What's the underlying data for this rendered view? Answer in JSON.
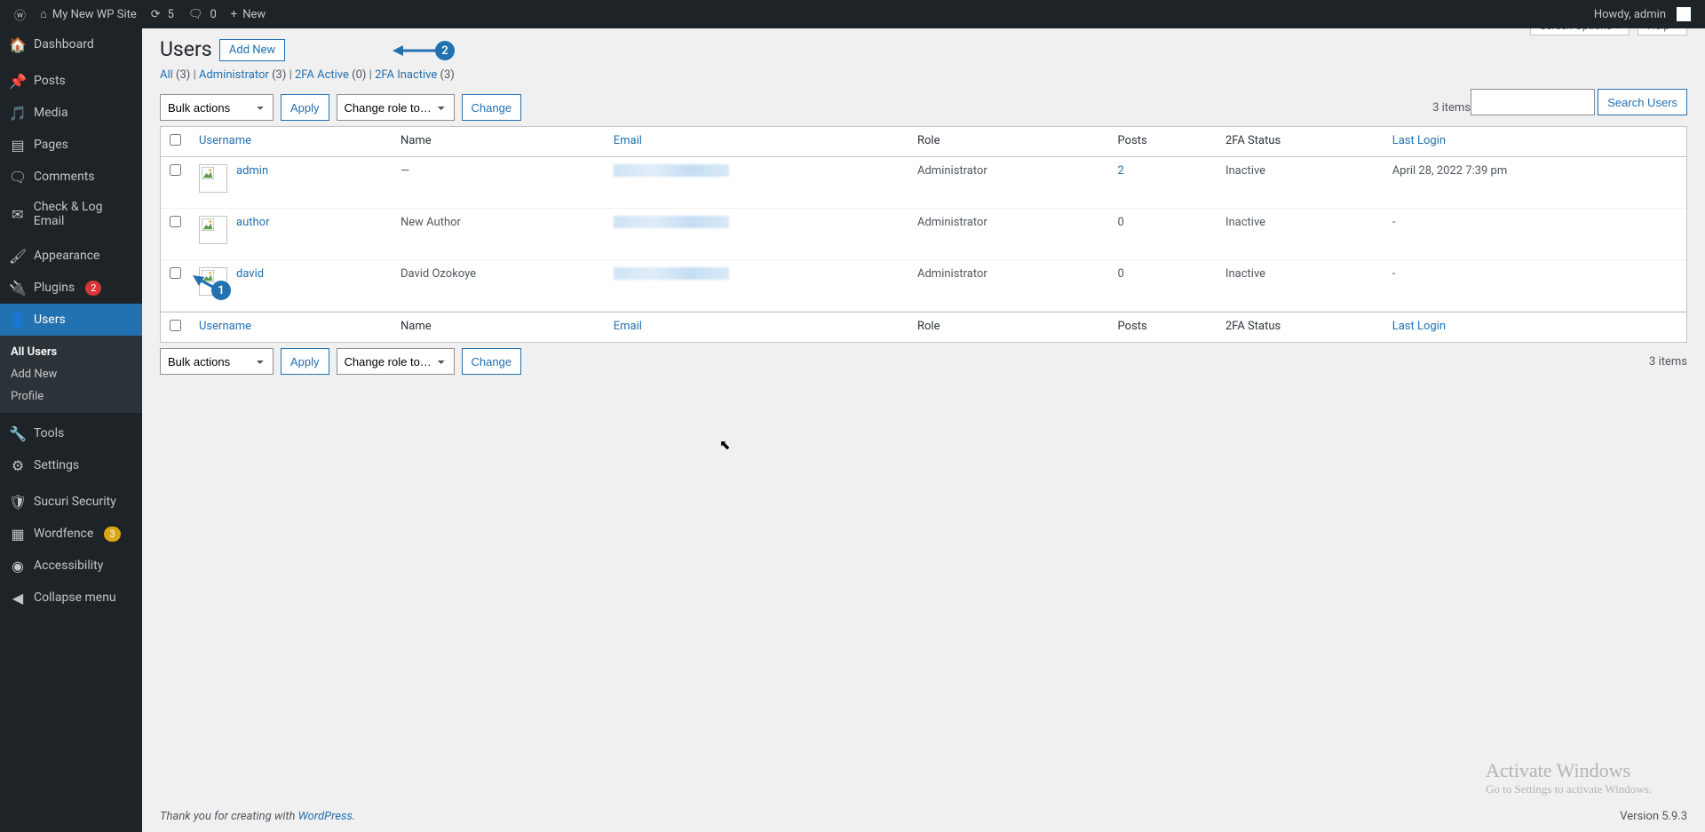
{
  "adminbar": {
    "site_name": "My New WP Site",
    "updates": "5",
    "comments": "0",
    "new_label": "New",
    "howdy": "Howdy, admin"
  },
  "menu": {
    "dashboard": "Dashboard",
    "posts": "Posts",
    "media": "Media",
    "pages": "Pages",
    "comments": "Comments",
    "check_email": "Check & Log Email",
    "appearance": "Appearance",
    "plugins": "Plugins",
    "plugins_count": "2",
    "users": "Users",
    "users_sub": {
      "all": "All Users",
      "add": "Add New",
      "profile": "Profile"
    },
    "tools": "Tools",
    "settings": "Settings",
    "sucuri": "Sucuri Security",
    "wordfence": "Wordfence",
    "wordfence_count": "3",
    "accessibility": "Accessibility",
    "collapse": "Collapse menu"
  },
  "screenmeta": {
    "options": "Screen Options",
    "help": "Help"
  },
  "heading": {
    "title": "Users",
    "add_new": "Add New"
  },
  "filters": {
    "all": "All",
    "all_count": "(3)",
    "admin": "Administrator",
    "admin_count": "(3)",
    "tfa_active": "2FA Active",
    "tfa_active_count": "(0)",
    "tfa_inactive": "2FA Inactive",
    "tfa_inactive_count": "(3)"
  },
  "bulk": {
    "label": "Bulk actions",
    "apply": "Apply",
    "role": "Change role to…",
    "change": "Change"
  },
  "search": {
    "button": "Search Users"
  },
  "count": "3 items",
  "columns": {
    "username": "Username",
    "name": "Name",
    "email": "Email",
    "role": "Role",
    "posts": "Posts",
    "tfa": "2FA Status",
    "last": "Last Login"
  },
  "rows": [
    {
      "username": "admin",
      "name": "—",
      "role": "Administrator",
      "posts": "2",
      "posts_link": true,
      "tfa": "Inactive",
      "last": "April 28, 2022 7:39 pm"
    },
    {
      "username": "author",
      "name": "New Author",
      "role": "Administrator",
      "posts": "0",
      "posts_link": false,
      "tfa": "Inactive",
      "last": "-"
    },
    {
      "username": "david",
      "name": "David Ozokoye",
      "role": "Administrator",
      "posts": "0",
      "posts_link": false,
      "tfa": "Inactive",
      "last": "-"
    }
  ],
  "footer": {
    "thanks_prefix": "Thank you for creating with ",
    "wp": "WordPress",
    "version": "Version 5.9.3"
  },
  "watermark": {
    "l1": "Activate Windows",
    "l2": "Go to Settings to activate Windows."
  },
  "annotations": {
    "one": "1",
    "two": "2"
  }
}
